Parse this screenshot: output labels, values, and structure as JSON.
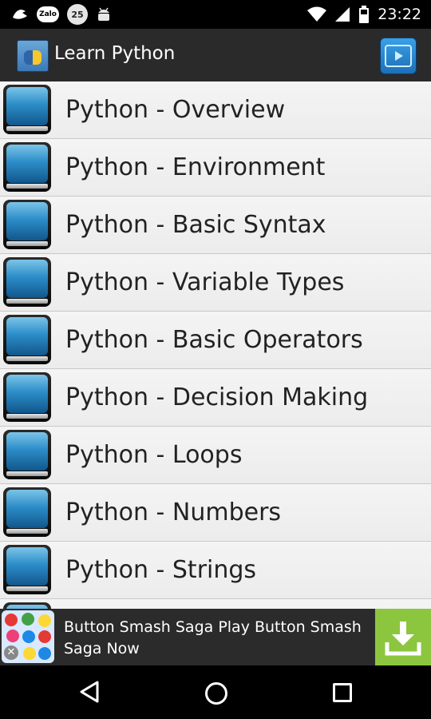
{
  "status_bar": {
    "zalo_label": "Zalo",
    "badge_count": "25",
    "time": "23:22",
    "icons": [
      "bird-icon",
      "zalo-icon",
      "badge-icon",
      "android-icon",
      "wifi-icon",
      "cell-signal-icon",
      "battery-icon"
    ]
  },
  "action_bar": {
    "title": "Learn Python",
    "app_icon_label": "PYTHON"
  },
  "list": {
    "items": [
      {
        "label": "Python - Overview"
      },
      {
        "label": "Python - Environment"
      },
      {
        "label": "Python - Basic Syntax"
      },
      {
        "label": "Python - Variable Types"
      },
      {
        "label": "Python - Basic Operators"
      },
      {
        "label": "Python - Decision Making"
      },
      {
        "label": "Python - Loops"
      },
      {
        "label": "Python - Numbers"
      },
      {
        "label": "Python - Strings"
      },
      {
        "label": ""
      }
    ]
  },
  "ad": {
    "text": "Button Smash Saga Play Button Smash Saga Now",
    "close_glyph": "✕",
    "download_color": "#8cc63f"
  },
  "colors": {
    "action_bar": "#2a2a2a",
    "list_bg": "#f1f1f1",
    "book_blue": "#2c8dc8"
  }
}
